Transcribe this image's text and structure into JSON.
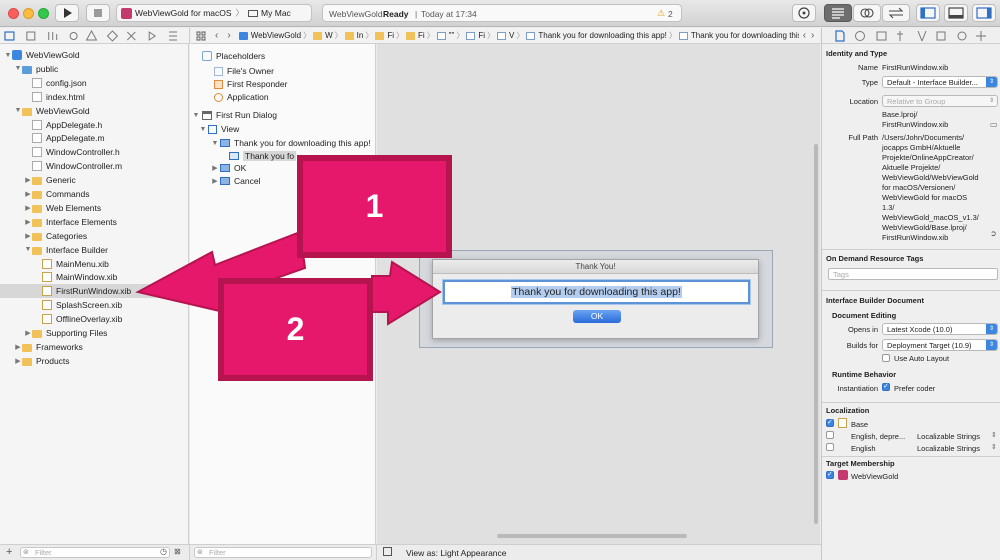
{
  "toolbar": {
    "scheme_target": "WebViewGold for macOS",
    "scheme_device": "My Mac",
    "status_app": "WebViewGold:",
    "status_state": "Ready",
    "status_time": "Today at 17:34",
    "warning_count": "2"
  },
  "navigator": {
    "filter_placeholder": "Filter",
    "items": [
      {
        "label": "WebViewGold",
        "level": 0,
        "icon": "project-icon",
        "open": true
      },
      {
        "label": "public",
        "level": 1,
        "icon": "folder-blue-icon",
        "open": true
      },
      {
        "label": "config.json",
        "level": 2,
        "icon": "json-file-icon"
      },
      {
        "label": "index.html",
        "level": 2,
        "icon": "html-file-icon"
      },
      {
        "label": "WebViewGold",
        "level": 1,
        "icon": "folder-icon",
        "open": true
      },
      {
        "label": "AppDelegate.h",
        "level": 2,
        "icon": "h-file-icon"
      },
      {
        "label": "AppDelegate.m",
        "level": 2,
        "icon": "m-file-icon"
      },
      {
        "label": "WindowController.h",
        "level": 2,
        "icon": "h-file-icon"
      },
      {
        "label": "WindowController.m",
        "level": 2,
        "icon": "m-file-icon"
      },
      {
        "label": "Generic",
        "level": 2,
        "icon": "folder-icon",
        "closed": true
      },
      {
        "label": "Commands",
        "level": 2,
        "icon": "folder-icon",
        "closed": true
      },
      {
        "label": "Web Elements",
        "level": 2,
        "icon": "folder-icon",
        "closed": true
      },
      {
        "label": "Interface Elements",
        "level": 2,
        "icon": "folder-icon",
        "closed": true
      },
      {
        "label": "Categories",
        "level": 2,
        "icon": "folder-icon",
        "closed": true
      },
      {
        "label": "Interface Builder",
        "level": 2,
        "icon": "folder-icon",
        "open": true
      },
      {
        "label": "MainMenu.xib",
        "level": 3,
        "icon": "xib-file-icon"
      },
      {
        "label": "MainWindow.xib",
        "level": 3,
        "icon": "xib-file-icon"
      },
      {
        "label": "FirstRunWindow.xib",
        "level": 3,
        "icon": "xib-file-icon",
        "selected": true
      },
      {
        "label": "SplashScreen.xib",
        "level": 3,
        "icon": "xib-file-icon"
      },
      {
        "label": "OfflineOverlay.xib",
        "level": 3,
        "icon": "xib-file-icon"
      },
      {
        "label": "Supporting Files",
        "level": 2,
        "icon": "folder-icon",
        "closed": true
      },
      {
        "label": "Frameworks",
        "level": 1,
        "icon": "folder-icon",
        "closed": true
      },
      {
        "label": "Products",
        "level": 1,
        "icon": "folder-icon",
        "closed": true
      }
    ]
  },
  "jumpbar": {
    "crumbs": [
      "WebViewGold",
      "W",
      "In",
      "Fi",
      "Fi",
      "\"\"",
      "Fi",
      "V",
      "Thank you for downloading this app!",
      "Thank you for downloading this app!"
    ]
  },
  "outline": {
    "placeholders_header": "Placeholders",
    "placeholders": [
      "File's Owner",
      "First Responder",
      "Application"
    ],
    "dialog_header": "First Run Dialog",
    "view": "View",
    "tree": [
      {
        "label": "Thank you for downloading this app!",
        "indent": 2,
        "open": true
      },
      {
        "label": "Thank you fo",
        "indent": 3,
        "selected": true
      },
      {
        "label": "OK",
        "indent": 2,
        "closed": true
      },
      {
        "label": "Cancel",
        "indent": 2,
        "closed": true
      }
    ],
    "filter_placeholder": "Filter"
  },
  "canvas": {
    "window_title": "Thank You!",
    "textfield_value": "Thank you for downloading this app!",
    "ok_button": "OK",
    "view_as": "View as: Light Appearance"
  },
  "callouts": {
    "first": "1",
    "second": "2"
  },
  "inspector": {
    "identity_header": "Identity and Type",
    "name_label": "Name",
    "name_value": "FirstRunWindow.xib",
    "type_label": "Type",
    "type_value": "Default - Interface Builder...",
    "location_label": "Location",
    "location_value": "Relative to Group",
    "location_path": "Base.lproj/\nFirstRunWindow.xib",
    "fullpath_label": "Full Path",
    "fullpath_value": "/Users/John/Documents/\njocapps GmbH/Aktuelle\nProjekte/OnlineAppCreator/\nAktuelle Projekte/\nWebViewGold/WebViewGold\nfor macOS/Versionen/\nWebViewGold for macOS\n1.3/\nWebViewGold_macOS_v1.3/\nWebViewGold/Base.lproj/\nFirstRunWindow.xib",
    "ondemand_header": "On Demand Resource Tags",
    "tags_placeholder": "Tags",
    "ibdoc_header": "Interface Builder Document",
    "doc_editing": "Document Editing",
    "opens_in_label": "Opens in",
    "opens_in_value": "Latest Xcode (10.0)",
    "builds_for_label": "Builds for",
    "builds_for_value": "Deployment Target (10.9)",
    "auto_layout": "Use Auto Layout",
    "runtime_behavior": "Runtime Behavior",
    "instantiation_label": "Instantiation",
    "prefer_coder": "Prefer coder",
    "localization_header": "Localization",
    "loc_base": "Base",
    "loc_english_dep": "English, depre...",
    "loc_english_dep_type": "Localizable Strings",
    "loc_english": "English",
    "loc_english_type": "Localizable Strings",
    "target_header": "Target Membership",
    "target_name": "WebViewGold"
  }
}
